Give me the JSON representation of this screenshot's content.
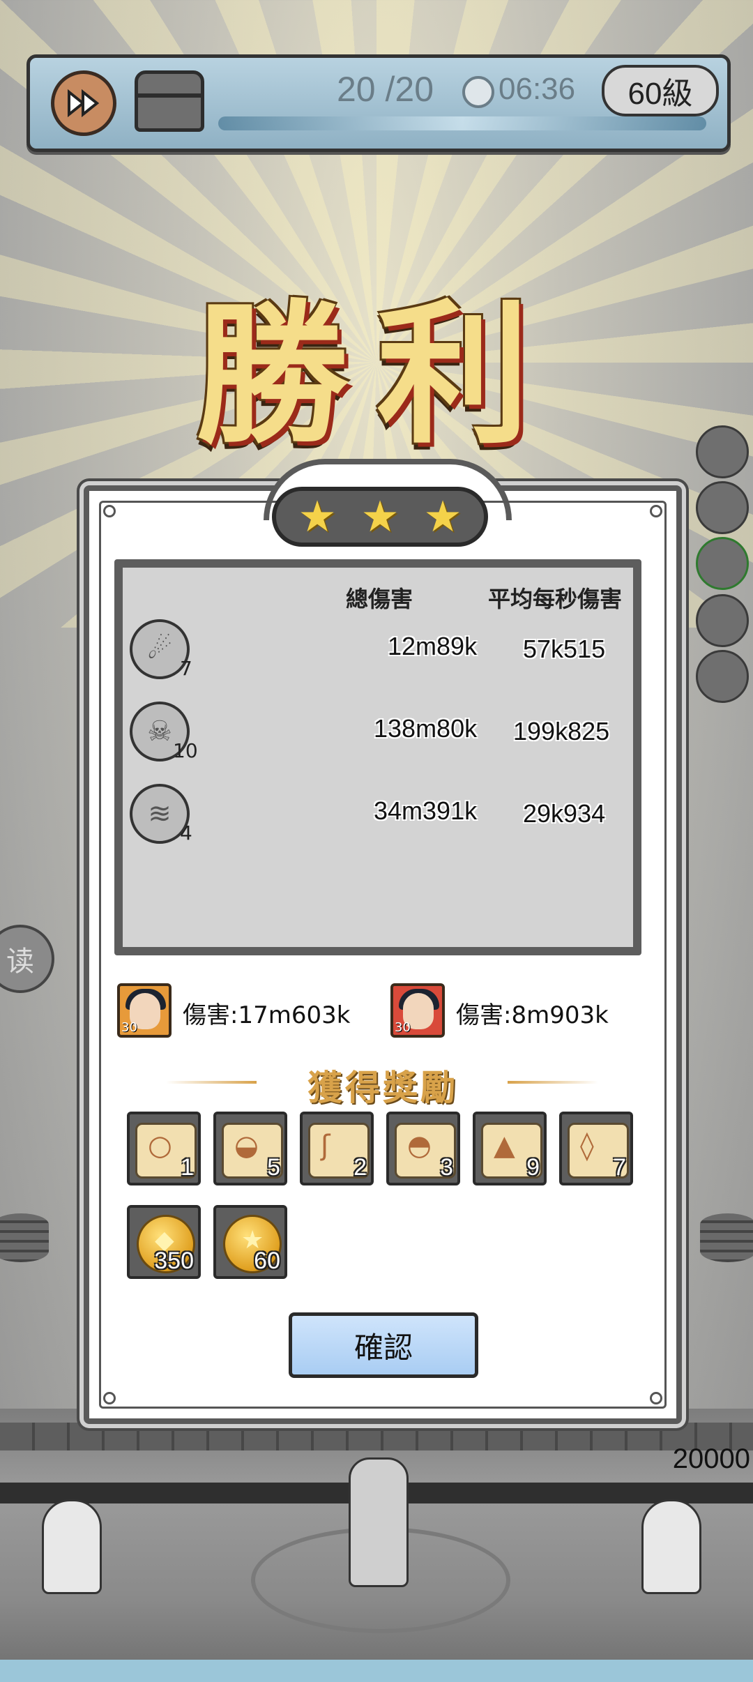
{
  "topbar": {
    "energy": "20 /20",
    "timer": "06:36",
    "level": "60級",
    "fast_forward_icon": "fast-forward-icon",
    "chest_icon": "treasure-chest-icon"
  },
  "victory_title": "勝利",
  "rating": {
    "stars": 3,
    "max": 3
  },
  "stats": {
    "col_total": "總傷害",
    "col_dps": "平均每秒傷害",
    "rows": [
      {
        "skill": "meteor-skill-icon",
        "level": "7",
        "total": "12m89k",
        "dps": "57k515"
      },
      {
        "skill": "ghost-skill-icon",
        "level": "10",
        "total": "138m80k",
        "dps": "199k825"
      },
      {
        "skill": "tornado-skill-icon",
        "level": "4",
        "total": "34m391k",
        "dps": "29k934"
      }
    ]
  },
  "heroes": [
    {
      "level": "30",
      "damage": "傷害:17m603k",
      "frame": "#e79a3a"
    },
    {
      "level": "30",
      "damage": "傷害:8m903k",
      "frame": "#d94a3a"
    }
  ],
  "rewards_title": "獲得獎勵",
  "rewards": [
    {
      "icon": "scroll-ring-icon",
      "qty": "1"
    },
    {
      "icon": "scroll-hat-icon",
      "qty": "5"
    },
    {
      "icon": "scroll-cane-icon",
      "qty": "2"
    },
    {
      "icon": "scroll-helmet-icon",
      "qty": "3"
    },
    {
      "icon": "scroll-cloak-icon",
      "qty": "9"
    },
    {
      "icon": "scroll-amulet-icon",
      "qty": "7"
    },
    {
      "icon": "gold-gem-coin-icon",
      "qty": "350"
    },
    {
      "icon": "gold-star-coin-icon",
      "qty": "60"
    }
  ],
  "confirm_label": "確認",
  "side": {
    "read_label": "读",
    "wall_hp": "20000"
  },
  "colors": {
    "gold_text": "#f5dd8a",
    "confirm_bg": "#a9cdf3",
    "star": "#f4d24a"
  }
}
